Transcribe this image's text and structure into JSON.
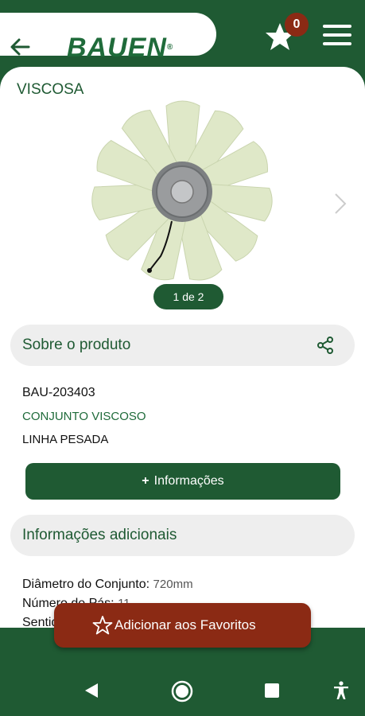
{
  "header": {
    "logo_text": "BAUEN",
    "logo_mark": "®",
    "favorites_count": "0",
    "icons": [
      "arrow-left-icon",
      "star-icon",
      "hamburger-menu-icon"
    ]
  },
  "product": {
    "title": "VISCOSA",
    "image_pager": "1 de 2"
  },
  "about": {
    "title": "Sobre o produto",
    "code": "BAU-203403",
    "name": "CONJUNTO VISCOSO",
    "line": "LINHA PESADA",
    "info_button": "Informações"
  },
  "additional": {
    "title": "Informações adicionais",
    "specs": [
      {
        "label": "Diâmetro do Conjunto:",
        "value": "720mm"
      },
      {
        "label": "Número de Pás:",
        "value": "11"
      },
      {
        "label": "Sentido de Rotação:",
        "value": ""
      }
    ]
  },
  "favorite_button": "Adicionar aos Favoritos",
  "colors": {
    "brand_green": "#1f5a33",
    "accent_red": "#8b2a14"
  }
}
